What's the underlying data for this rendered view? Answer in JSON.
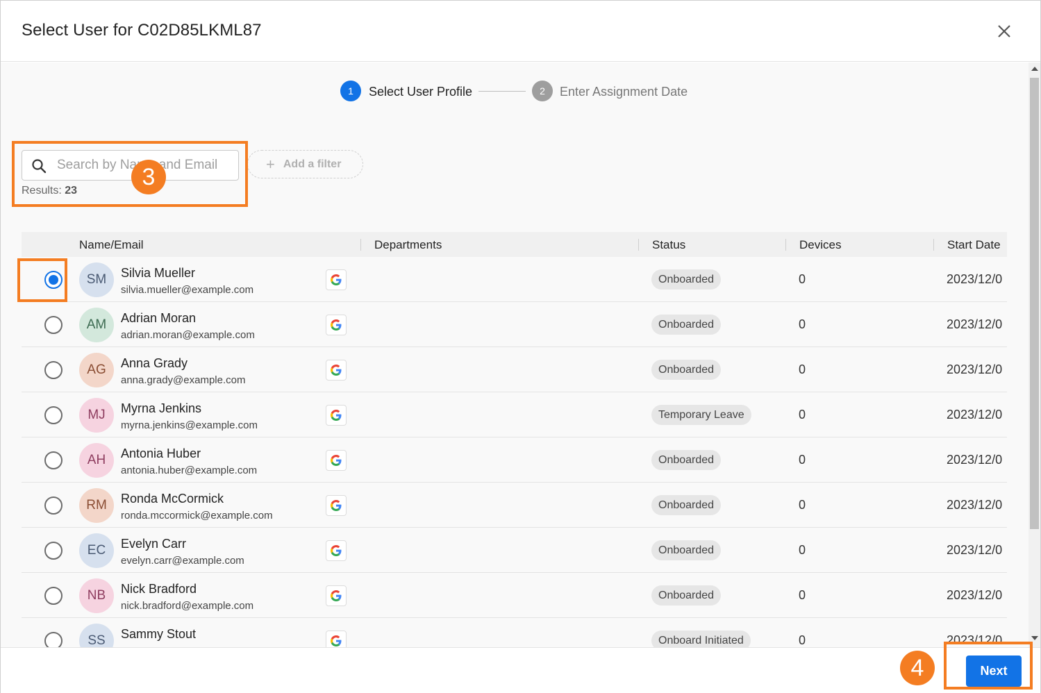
{
  "dialog": {
    "title": "Select User for C02D85LKML87"
  },
  "stepper": {
    "steps": [
      {
        "number": "1",
        "label": "Select User Profile",
        "active": true
      },
      {
        "number": "2",
        "label": "Enter Assignment Date",
        "active": false
      }
    ]
  },
  "annotations": {
    "badge_search": "3",
    "badge_next": "4"
  },
  "search": {
    "placeholder": "Search by Name and Email",
    "value": "",
    "results_label": "Results:",
    "results_count": "23"
  },
  "filter": {
    "add_label": "Add a filter"
  },
  "table": {
    "columns": [
      "Name/Email",
      "Departments",
      "Status",
      "Devices",
      "Start Date"
    ],
    "rows": [
      {
        "initials": "SM",
        "name": "Silvia Mueller",
        "email": "silvia.mueller@example.com",
        "status": "Onboarded",
        "devices": "0",
        "start_date": "2023/12/0",
        "selected": true,
        "avatar_bg": "#d6e0ee",
        "avatar_fg": "#4a5a73"
      },
      {
        "initials": "AM",
        "name": "Adrian Moran",
        "email": "adrian.moran@example.com",
        "status": "Onboarded",
        "devices": "0",
        "start_date": "2023/12/0",
        "selected": false,
        "avatar_bg": "#d3e8dc",
        "avatar_fg": "#3d6b52"
      },
      {
        "initials": "AG",
        "name": "Anna Grady",
        "email": "anna.grady@example.com",
        "status": "Onboarded",
        "devices": "0",
        "start_date": "2023/12/0",
        "selected": false,
        "avatar_bg": "#f3d6c9",
        "avatar_fg": "#8a4d33"
      },
      {
        "initials": "MJ",
        "name": "Myrna Jenkins",
        "email": "myrna.jenkins@example.com",
        "status": "Temporary Leave",
        "devices": "0",
        "start_date": "2023/12/0",
        "selected": false,
        "avatar_bg": "#f6d3e0",
        "avatar_fg": "#8e3d5f"
      },
      {
        "initials": "AH",
        "name": "Antonia Huber",
        "email": "antonia.huber@example.com",
        "status": "Onboarded",
        "devices": "0",
        "start_date": "2023/12/0",
        "selected": false,
        "avatar_bg": "#f6d3e0",
        "avatar_fg": "#8e3d5f"
      },
      {
        "initials": "RM",
        "name": "Ronda McCormick",
        "email": "ronda.mccormick@example.com",
        "status": "Onboarded",
        "devices": "0",
        "start_date": "2023/12/0",
        "selected": false,
        "avatar_bg": "#f3d6c9",
        "avatar_fg": "#8a4d33"
      },
      {
        "initials": "EC",
        "name": "Evelyn Carr",
        "email": "evelyn.carr@example.com",
        "status": "Onboarded",
        "devices": "0",
        "start_date": "2023/12/0",
        "selected": false,
        "avatar_bg": "#d6e0ee",
        "avatar_fg": "#4a5a73"
      },
      {
        "initials": "NB",
        "name": "Nick Bradford",
        "email": "nick.bradford@example.com",
        "status": "Onboarded",
        "devices": "0",
        "start_date": "2023/12/0",
        "selected": false,
        "avatar_bg": "#f6d3e0",
        "avatar_fg": "#8e3d5f"
      },
      {
        "initials": "SS",
        "name": "Sammy Stout",
        "email": "",
        "status": "Onboard Initiated",
        "devices": "0",
        "start_date": "2023/12/0",
        "selected": false,
        "avatar_bg": "#d6e0ee",
        "avatar_fg": "#4a5a73"
      }
    ]
  },
  "footer": {
    "next_label": "Next"
  },
  "colors": {
    "primary": "#1273e6",
    "annotation": "#f47d22",
    "step_inactive": "#9e9e9e"
  },
  "icons": [
    "close-icon",
    "search-icon",
    "plus-icon",
    "google-icon",
    "scroll-up-arrow",
    "scroll-down-arrow"
  ]
}
